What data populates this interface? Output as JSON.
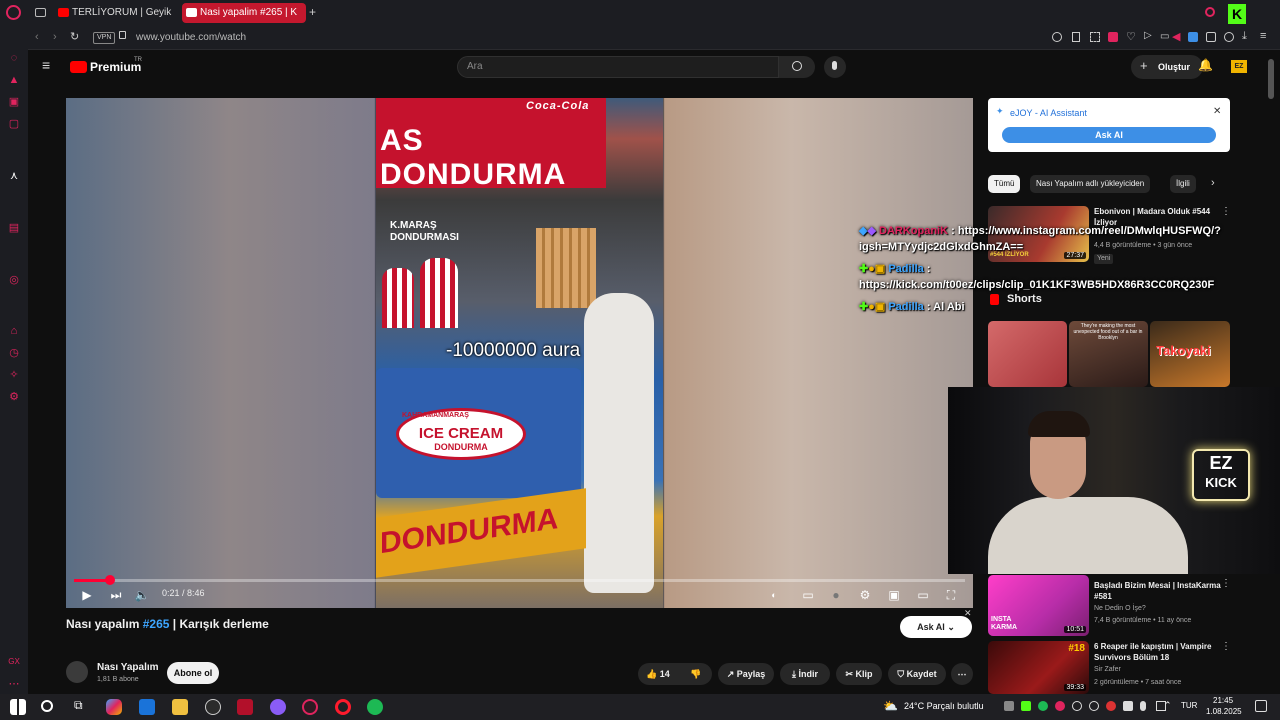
{
  "browser": {
    "tabs": [
      {
        "label": "TERLİYORUM | GeyikPost"
      },
      {
        "label": "Nasi yapalim #265 | K"
      }
    ],
    "address": "www.youtube.com/watch",
    "vpn": "VPN"
  },
  "youtube": {
    "logo": "Premium",
    "logo_region": "TR",
    "search_placeholder": "Ara",
    "create_label": "Oluştur",
    "ez_badge": "EZ"
  },
  "video": {
    "sign_text": "AS DONDURMA",
    "cart_brand": "Coca-Cola",
    "kmaras_text": "K.MARAŞ DONDURMASI",
    "icecream_text": "ICE CREAM",
    "icecream_sub": "DONDURMA",
    "kahramanmaras": "KAHRAMANMARAŞ",
    "bottom_text": "DONDURMA",
    "overlay_text": "-10000000 aura",
    "time": "0:21 / 8:46",
    "progress": 0.04
  },
  "meta": {
    "title_prefix": "Nası yapalım",
    "title_tag": "#265",
    "title_suffix": "| Karışık derleme",
    "ask_ai": "Ask AI",
    "channel": "Nası Yapalım",
    "subscribers": "1,81 B abone",
    "subscribe": "Abone ol",
    "likes": "14",
    "share": "Paylaş",
    "download": "İndir",
    "clip": "Klip",
    "save": "Kaydet"
  },
  "ejoy": {
    "title": "eJOY - AI Assistant",
    "button": "Ask AI"
  },
  "chips": [
    "Tümü",
    "Nası Yapalım adlı yükleyiciden",
    "İlgili"
  ],
  "recommended": [
    {
      "title": "Ebonivon | Madara Olduk #544 İzliyor",
      "meta": "4,4 B görüntüleme • 3 gün önce",
      "badge": "Yeni",
      "duration": "27:37",
      "thumb_text": "#544 İZLİYOR"
    },
    {
      "title": "Başladı Bizim Mesai | InstaKarma #581",
      "channel": "Ne Dedin O İşe?",
      "meta": "7,4 B görüntüleme • 11 ay önce",
      "duration": "10:51",
      "thumb_text": "INSTA KARMA"
    },
    {
      "title": "6 Reaper ile kapıştım | Vampire Survivors Bölüm 18",
      "channel": "Sir Zafer",
      "meta": "2 görüntüleme • 7 saat önce",
      "duration": "39:33",
      "thumb_text": "#18"
    }
  ],
  "shorts": {
    "label": "Shorts",
    "items": [
      {
        "text": ""
      },
      {
        "text": "They're making the most unexpected food out of a bar in Brooklyn"
      },
      {
        "text": "Takoyaki"
      }
    ]
  },
  "chat": [
    {
      "user": "DARKopaniK",
      "message": ": https://www.instagram.com/reel/DMwlqHUSFWQ/?",
      "message2": "igsh=MTYydjc2dGlxdGhmZA=="
    },
    {
      "user": "Padilla",
      "message": ":",
      "message2": "https://kick.com/t00ez/clips/clip_01K1KF3WB5HDX86R3CC0RQ230F"
    },
    {
      "user": "Padilla",
      "message": ": Al Abi"
    }
  ],
  "webcam": {
    "sign_line1": "EZ",
    "sign_line2": "KICK"
  },
  "taskbar": {
    "weather": "24°C  Parçalı bulutlu",
    "lang": "TUR",
    "time": "21:45",
    "date": "1.08.2025"
  },
  "colors": {
    "accent": "#ff0033",
    "opera_red": "#e0245e",
    "link_blue": "#3ea6ff"
  }
}
